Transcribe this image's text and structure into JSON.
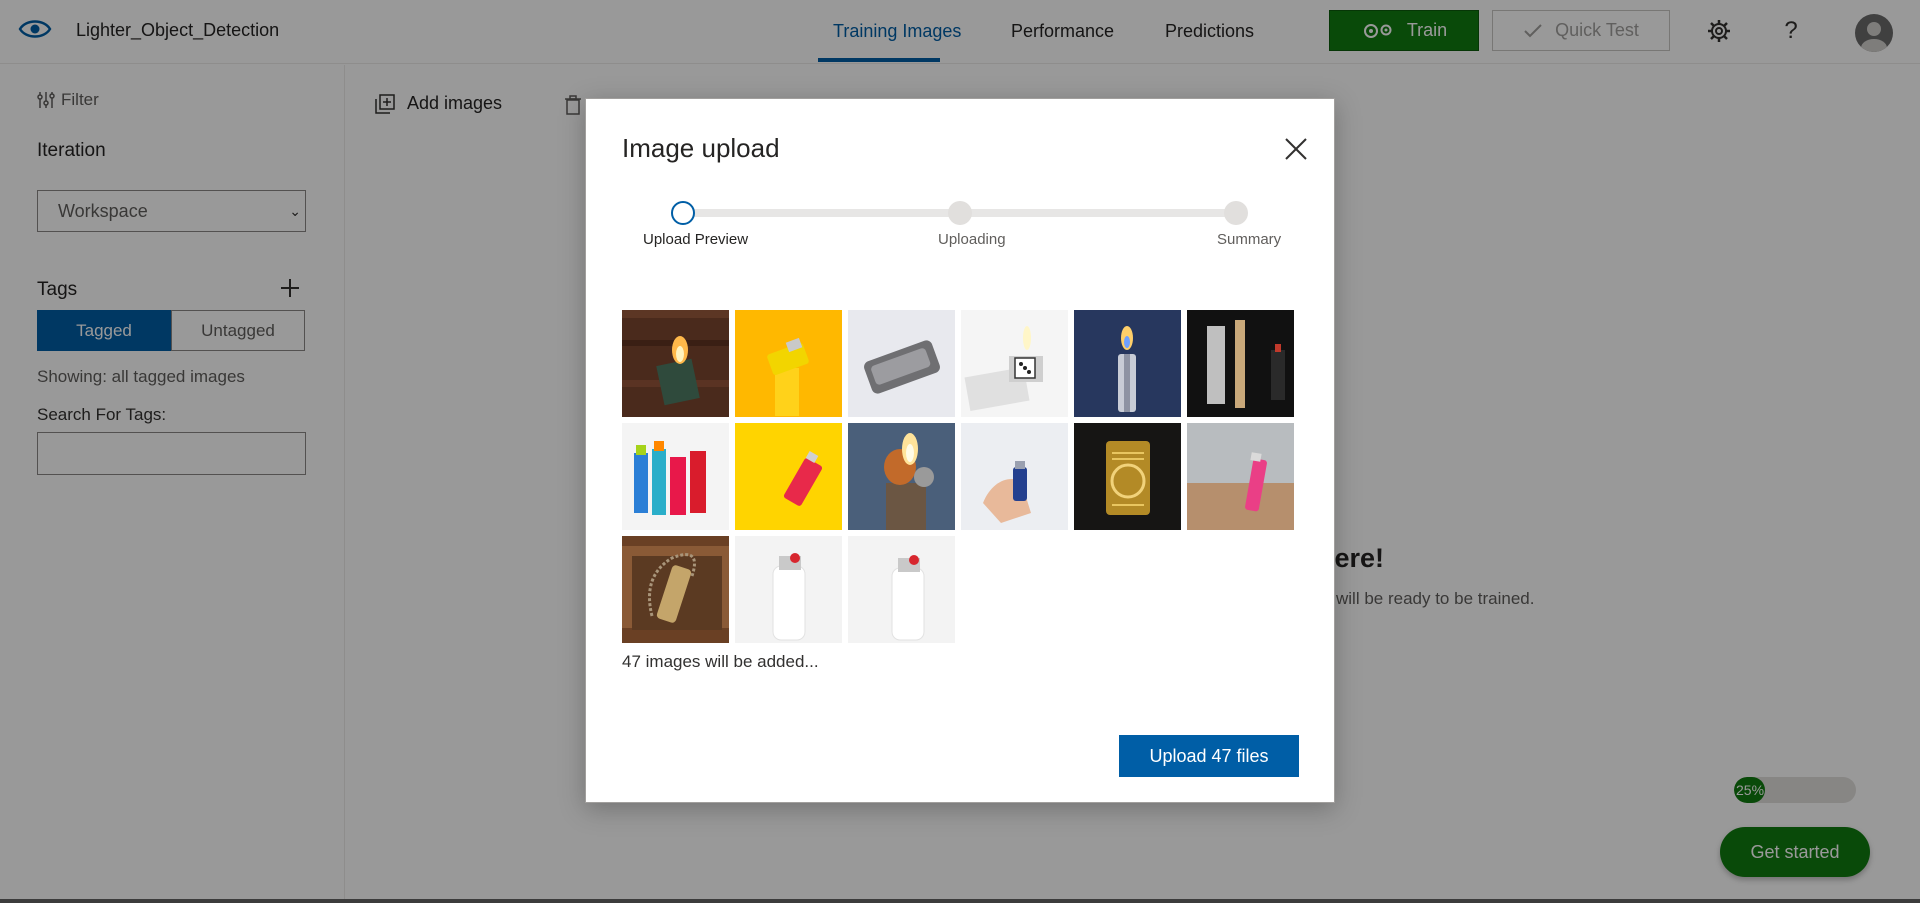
{
  "header": {
    "project_name": "Lighter_Object_Detection",
    "tabs": [
      {
        "label": "Training Images",
        "active": true
      },
      {
        "label": "Performance",
        "active": false
      },
      {
        "label": "Predictions",
        "active": false
      }
    ],
    "train_label": "Train",
    "quick_test_label": "Quick Test",
    "icons": [
      "eye-logo-icon",
      "gear-icon",
      "help-icon",
      "user-avatar"
    ]
  },
  "sidebar": {
    "filter_label": "Filter",
    "iteration_label": "Iteration",
    "iteration_value": "Workspace",
    "tags_label": "Tags",
    "tag_toggle": [
      "Tagged",
      "Untagged"
    ],
    "showing_text": "Showing: all tagged images",
    "search_label": "Search For Tags:",
    "search_value": ""
  },
  "main": {
    "add_images_label": "Add images",
    "empty_title_visible": "here!",
    "empty_sub_visible": "will be ready to be trained.",
    "progress_label": "25%",
    "progress_value": 0.25,
    "get_started_label": "Get started"
  },
  "modal": {
    "title": "Image upload",
    "steps": [
      {
        "label": "Upload Preview",
        "current": true
      },
      {
        "label": "Uploading",
        "current": false
      },
      {
        "label": "Summary",
        "current": false
      }
    ],
    "thumbnails": [
      "lighter-flame-dark-wood",
      "yellow-lighter-orange-bg",
      "silver-zippo-lighter",
      "open-zippo-dice-lighter",
      "lit-lighter-blue-bg",
      "metal-lighters-black-bg",
      "colorful-disposable-lighters",
      "pink-lighter-yellow-bg",
      "lit-antique-lighter",
      "hand-holding-lighter",
      "gold-ornate-lighter",
      "pink-lighter-sand",
      "brass-lighter-chain",
      "white-bic-lighter",
      "white-bic-lighter-2"
    ],
    "count_text": "47 images will be added...",
    "upload_button_label": "Upload 47 files"
  },
  "colors": {
    "accent_blue": "#005ea6",
    "train_green": "#107c10"
  }
}
